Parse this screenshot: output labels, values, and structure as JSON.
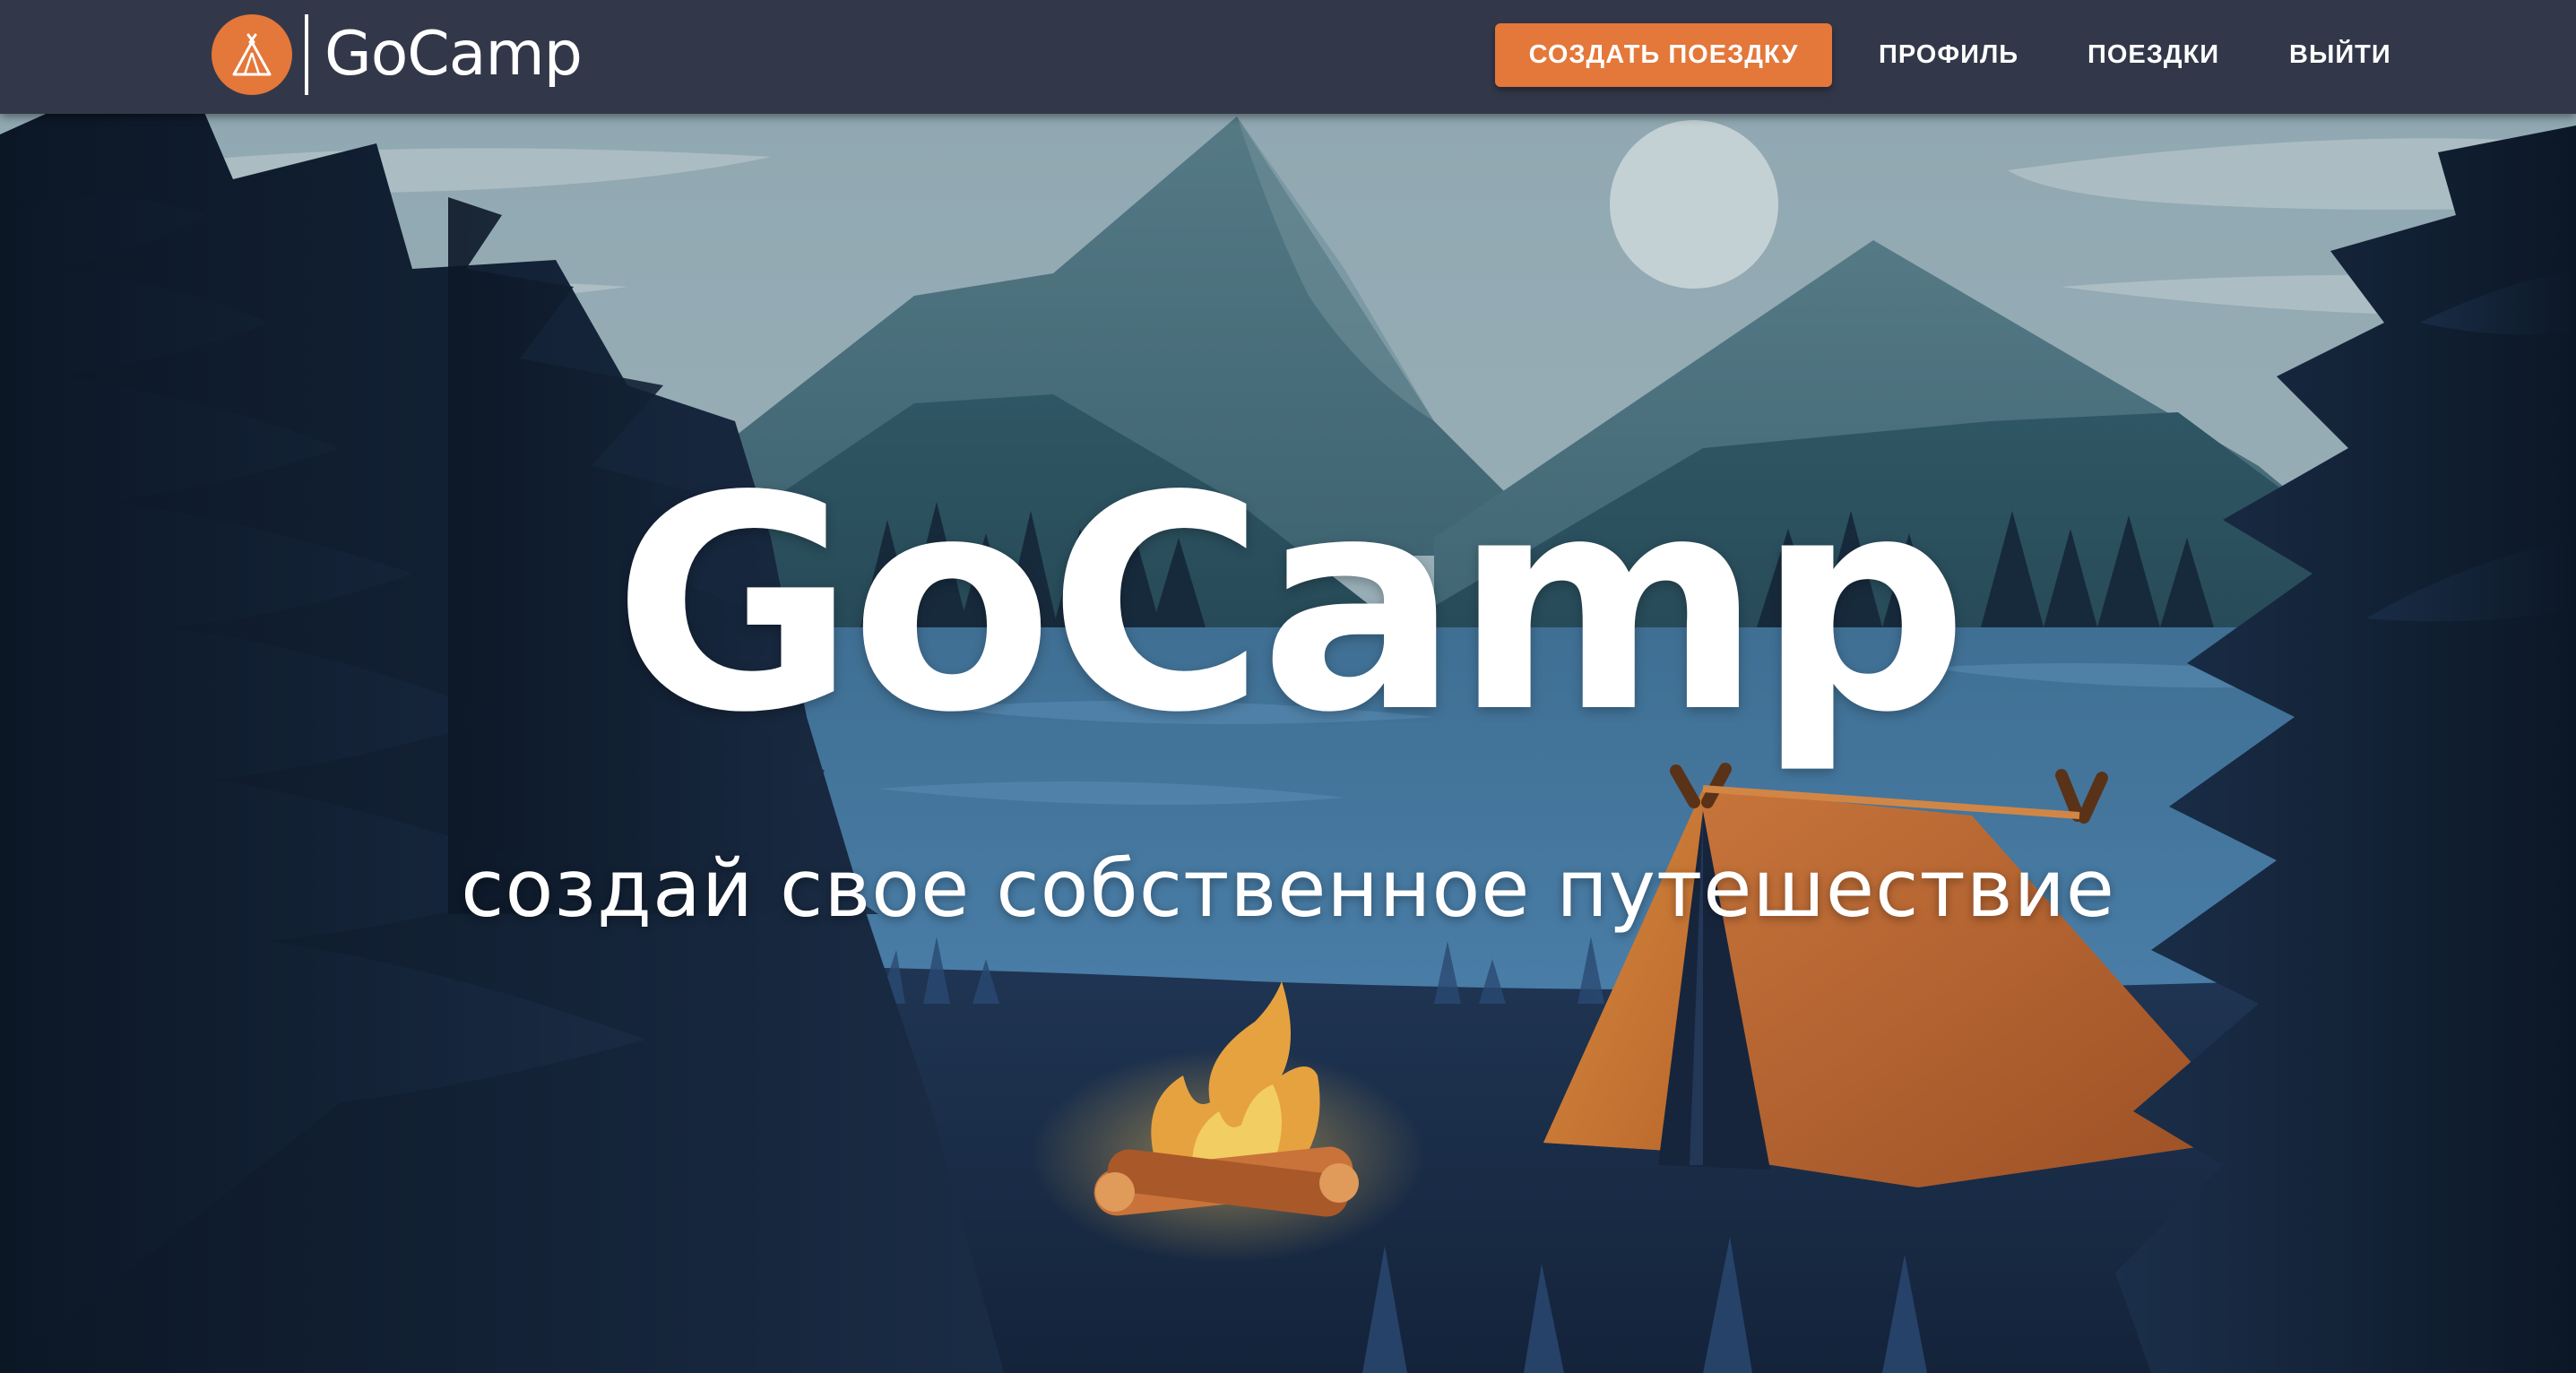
{
  "navbar": {
    "brand_name": "GoCamp",
    "logo_icon": "tent-icon",
    "create_trip_label": "СОЗДАТЬ ПОЕЗДКУ",
    "profile_label": "ПРОФИЛЬ",
    "trips_label": "ПОЕЗДКИ",
    "logout_label": "ВЫЙТИ"
  },
  "hero": {
    "title": "GoCamp",
    "subtitle": "создай свое собственное путешествие"
  },
  "colors": {
    "navbar_bg": "#323849",
    "accent": "#e4773a",
    "text": "#ffffff"
  }
}
